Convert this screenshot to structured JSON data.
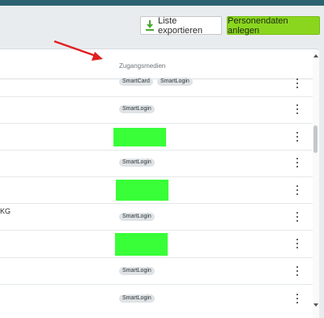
{
  "toolbar": {
    "export_label": "Liste exportieren",
    "create_label": "Personendaten anlegen"
  },
  "table": {
    "column_header": "Zugangsmedien",
    "rows": [
      {
        "chips": [
          "SmartCard",
          "SmartLogin"
        ],
        "redacted": false,
        "text": ""
      },
      {
        "chips": [
          "SmartLogin"
        ],
        "redacted": false,
        "text": ""
      },
      {
        "chips": [],
        "redacted": true,
        "text": ""
      },
      {
        "chips": [
          "SmartLogin"
        ],
        "redacted": false,
        "text": ""
      },
      {
        "chips": [],
        "redacted": true,
        "text": ""
      },
      {
        "chips": [
          "SmartLogin"
        ],
        "redacted": false,
        "text": "KG"
      },
      {
        "chips": [],
        "redacted": true,
        "text": ""
      },
      {
        "chips": [
          "SmartLogin"
        ],
        "redacted": false,
        "text": ""
      },
      {
        "chips": [
          "SmartLogin"
        ],
        "redacted": false,
        "text": ""
      }
    ]
  },
  "colors": {
    "header_bar": "#2d6270",
    "primary_button": "#8ad61f",
    "annotation_arrow": "#e02020",
    "redaction": "#38ff38"
  },
  "icons": [
    "download-icon",
    "kebab-menu-icon",
    "annotation-arrow",
    "scroll-up-icon",
    "scroll-down-icon"
  ]
}
